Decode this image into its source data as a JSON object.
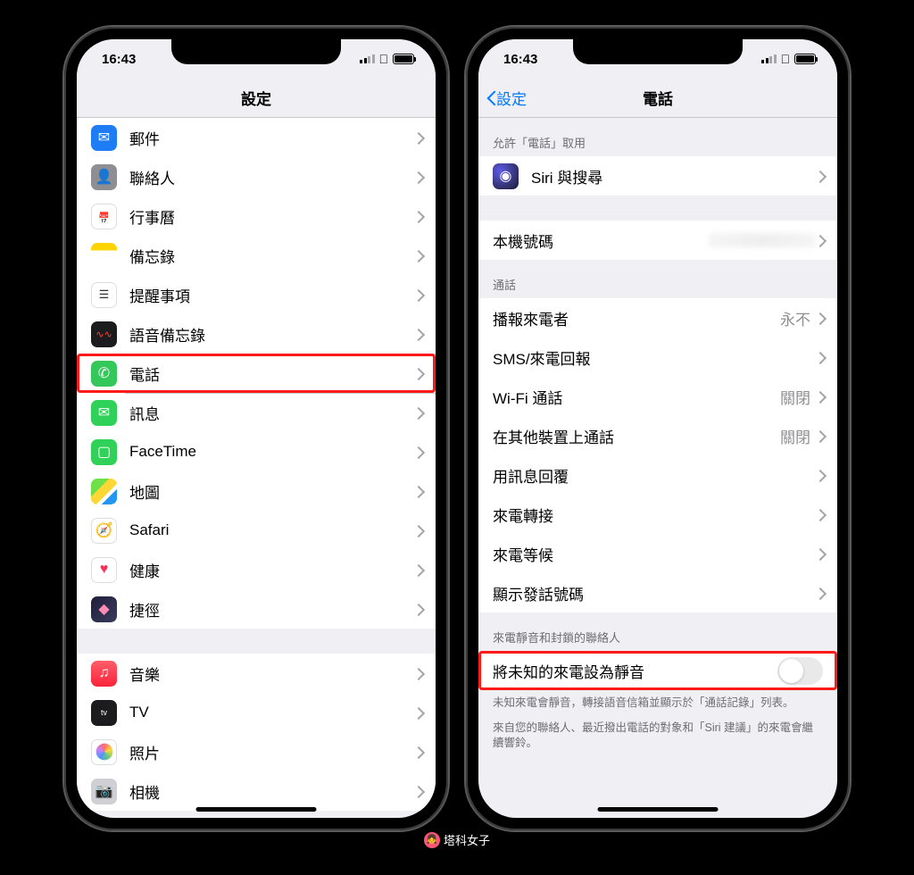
{
  "status": {
    "time": "16:43"
  },
  "left": {
    "nav": {
      "title": "設定"
    },
    "rows": [
      {
        "label": "郵件"
      },
      {
        "label": "聯絡人"
      },
      {
        "label": "行事曆"
      },
      {
        "label": "備忘錄"
      },
      {
        "label": "提醒事項"
      },
      {
        "label": "語音備忘錄"
      },
      {
        "label": "電話"
      },
      {
        "label": "訊息"
      },
      {
        "label": "FaceTime"
      },
      {
        "label": "地圖"
      },
      {
        "label": "Safari"
      },
      {
        "label": "健康"
      },
      {
        "label": "捷徑"
      },
      {
        "label": "音樂"
      },
      {
        "label": "TV"
      },
      {
        "label": "照片"
      },
      {
        "label": "相機"
      }
    ]
  },
  "right": {
    "nav": {
      "back": "設定",
      "title": "電話"
    },
    "sections": {
      "allow": {
        "header": "允許「電話」取用",
        "siri": "Siri 與搜尋"
      },
      "number": {
        "label": "本機號碼"
      },
      "calls": {
        "header": "通話",
        "announce": {
          "label": "播報來電者",
          "value": "永不"
        },
        "sms": "SMS/來電回報",
        "wifi": {
          "label": "Wi-Fi 通話",
          "value": "關閉"
        },
        "other": {
          "label": "在其他裝置上通話",
          "value": "關閉"
        },
        "replytext": "用訊息回覆",
        "forward": "來電轉接",
        "waiting": "來電等候",
        "callerid": "顯示發話號碼"
      },
      "silence": {
        "header": "來電靜音和封鎖的聯絡人",
        "toggle": "將未知的來電設為靜音",
        "footer1": "未知來電會靜音，轉接語音信箱並顯示於「通話記錄」列表。",
        "footer2": "來自您的聯絡人、最近撥出電話的對象和「Siri 建議」的來電會繼續響鈴。"
      }
    }
  },
  "watermark": "塔科女子"
}
